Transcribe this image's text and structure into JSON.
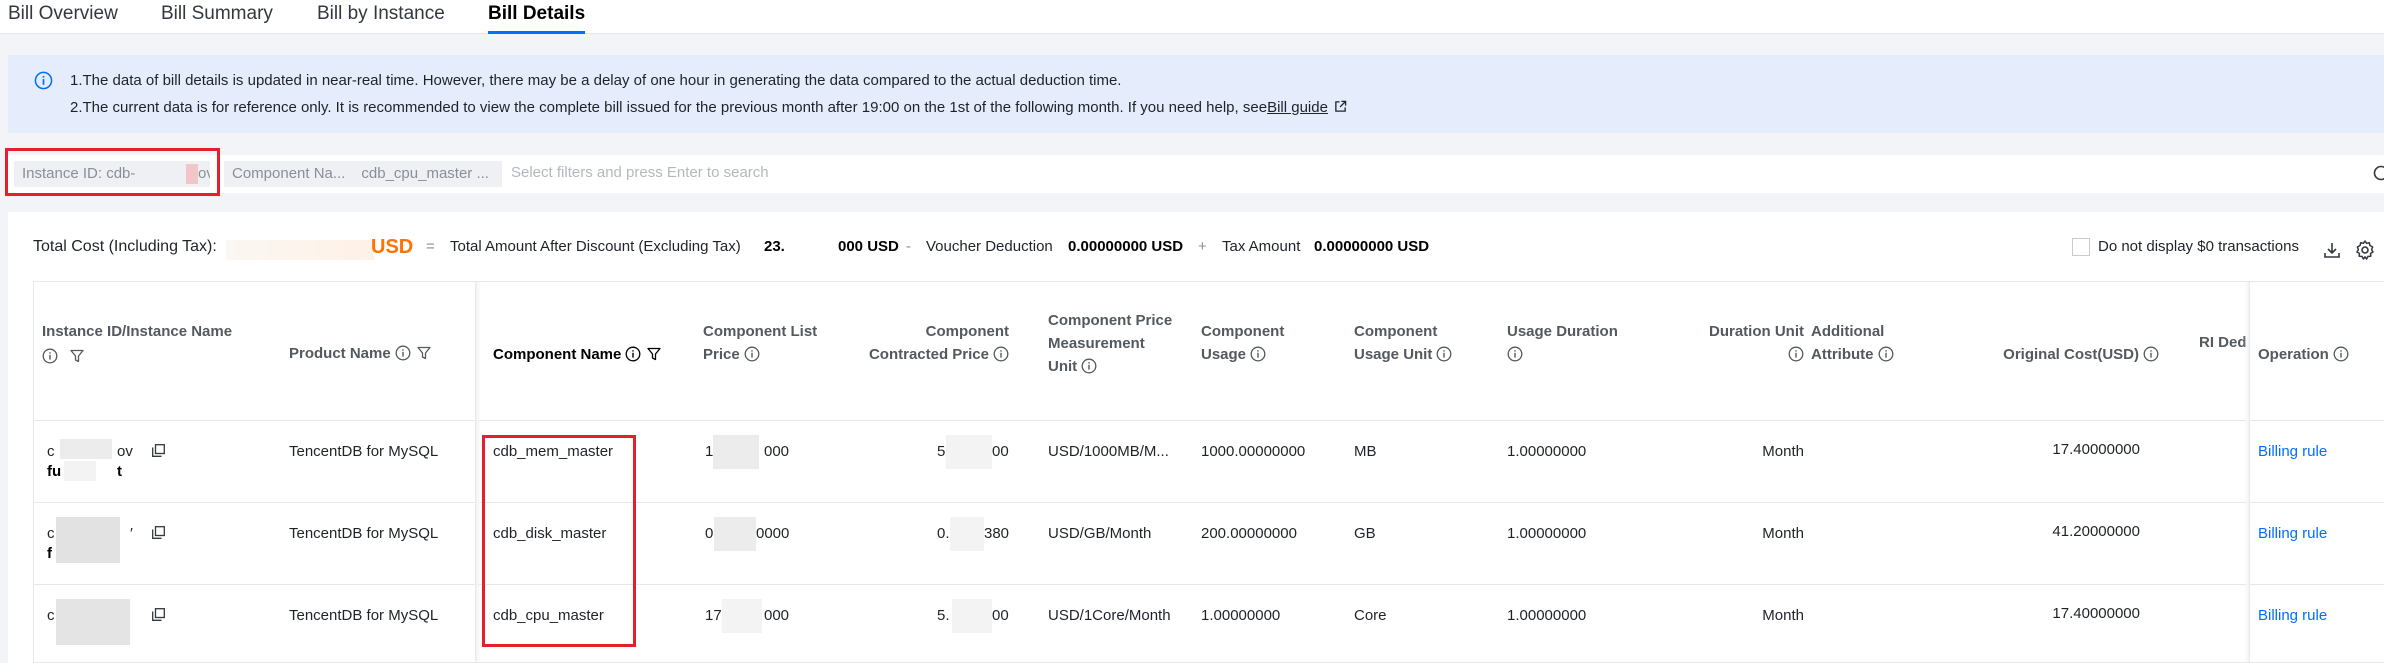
{
  "tabs": [
    {
      "label": "Bill Overview"
    },
    {
      "label": "Bill Summary"
    },
    {
      "label": "Bill by Instance"
    },
    {
      "label": "Bill Details",
      "active": true
    }
  ],
  "notice": {
    "line1": "1.The data of bill details is updated in near-real time. However, there may be a delay of one hour in generating the data compared to the actual deduction time.",
    "line2_prefix": "2.The current data is for reference only. It is recommended to view the complete bill issued for the previous month after 19:00 on the 1st of the following month. If you need help, see",
    "guide_link": "Bill guide"
  },
  "filters": {
    "instance_chip_label": "Instance ID: cdb-",
    "instance_chip_tail": "ov",
    "component_chip_label": "Component Na...",
    "component_chip_value": "cdb_cpu_master ...",
    "placeholder": "Select filters and press Enter to search"
  },
  "summary": {
    "total_label": "Total Cost (Including Tax):",
    "currency": "USD",
    "eq": "=",
    "after_discount_label": "Total Amount After Discount (Excluding Tax)",
    "after_discount_value_a": "23.",
    "after_discount_value_b": "000 USD",
    "minus": "-",
    "voucher_label": "Voucher Deduction",
    "voucher_value": "0.00000000 USD",
    "plus": "+",
    "tax_label": "Tax Amount",
    "tax_value": "0.00000000 USD",
    "zero_toggle_label": "Do not display $0 transactions"
  },
  "table": {
    "headers": {
      "instance": [
        "Instance ID/Instance Name"
      ],
      "product": "Product Name",
      "component": "Component Name",
      "list_price": [
        "Component List",
        "Price"
      ],
      "contracted_price": [
        "Component",
        "Contracted Price"
      ],
      "measurement": [
        "Component Price",
        "Measurement",
        "Unit"
      ],
      "usage": [
        "Component",
        "Usage"
      ],
      "usage_unit": [
        "Component",
        "Usage Unit"
      ],
      "duration": [
        "Usage Duration"
      ],
      "duration_unit": "Duration Unit",
      "additional": [
        "Additional",
        "Attribute"
      ],
      "original_cost": "Original Cost(USD)",
      "ri": "RI Ded",
      "operation": "Operation"
    },
    "rows": [
      {
        "instance_a": "c",
        "instance_b": "ov",
        "name_a": "fu",
        "name_b": "t",
        "product": "TencentDB for MySQL",
        "component": "cdb_mem_master",
        "list_price_a": "1",
        "list_price_b": "000",
        "contracted_a": "5",
        "contracted_b": "00",
        "measurement": "USD/1000MB/M...",
        "usage": "1000.00000000",
        "usage_unit": "MB",
        "duration": "1.00000000",
        "duration_unit": "Month",
        "original_cost": "17.40000000",
        "operation": "Billing rule"
      },
      {
        "instance_a": "c",
        "instance_b": "′",
        "name_a": "f",
        "name_b": "",
        "product": "TencentDB for MySQL",
        "component": "cdb_disk_master",
        "list_price_a": "0",
        "list_price_b": "0000",
        "contracted_a": "0.",
        "contracted_b": "380",
        "measurement": "USD/GB/Month",
        "usage": "200.00000000",
        "usage_unit": "GB",
        "duration": "1.00000000",
        "duration_unit": "Month",
        "original_cost": "41.20000000",
        "operation": "Billing rule"
      },
      {
        "instance_a": "c",
        "instance_b": "",
        "name_a": "",
        "name_b": "",
        "product": "TencentDB for MySQL",
        "component": "cdb_cpu_master",
        "list_price_a": "17",
        "list_price_b": "000",
        "contracted_a": "5.",
        "contracted_b": "00",
        "measurement": "USD/1Core/Month",
        "usage": "1.00000000",
        "usage_unit": "Core",
        "duration": "1.00000000",
        "duration_unit": "Month",
        "original_cost": "17.40000000",
        "operation": "Billing rule"
      }
    ]
  },
  "colors": {
    "accent": "#006eff",
    "highlight": "#e5202b",
    "usd": "#ff7200",
    "notice_bg": "#e5edfc"
  }
}
